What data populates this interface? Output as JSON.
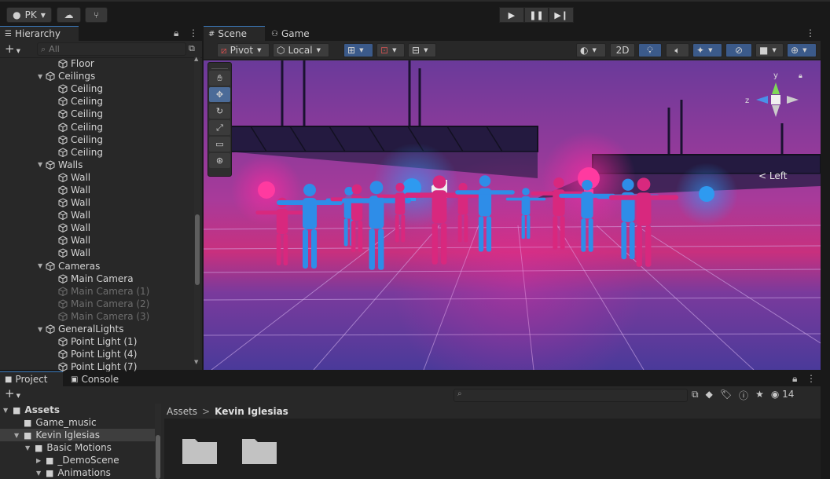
{
  "toolbar": {
    "account_label": "PK",
    "cloud_icon": "cloud-icon",
    "collab_icon": "branch-icon",
    "play_icon": "play-icon",
    "pause_icon": "pause-icon",
    "step_icon": "step-icon"
  },
  "hierarchy": {
    "tab_label": "Hierarchy",
    "add_label": "+",
    "search_placeholder": "All",
    "items": [
      {
        "label": "Floor",
        "depth": 2,
        "dim": false,
        "expander": ""
      },
      {
        "label": "Ceilings",
        "depth": 1,
        "dim": false,
        "expander": "▼"
      },
      {
        "label": "Ceiling",
        "depth": 2,
        "dim": false,
        "expander": ""
      },
      {
        "label": "Ceiling",
        "depth": 2,
        "dim": false,
        "expander": ""
      },
      {
        "label": "Ceiling",
        "depth": 2,
        "dim": false,
        "expander": ""
      },
      {
        "label": "Ceiling",
        "depth": 2,
        "dim": false,
        "expander": ""
      },
      {
        "label": "Ceiling",
        "depth": 2,
        "dim": false,
        "expander": ""
      },
      {
        "label": "Ceiling",
        "depth": 2,
        "dim": false,
        "expander": ""
      },
      {
        "label": "Walls",
        "depth": 1,
        "dim": false,
        "expander": "▼"
      },
      {
        "label": "Wall",
        "depth": 2,
        "dim": false,
        "expander": ""
      },
      {
        "label": "Wall",
        "depth": 2,
        "dim": false,
        "expander": ""
      },
      {
        "label": "Wall",
        "depth": 2,
        "dim": false,
        "expander": ""
      },
      {
        "label": "Wall",
        "depth": 2,
        "dim": false,
        "expander": ""
      },
      {
        "label": "Wall",
        "depth": 2,
        "dim": false,
        "expander": ""
      },
      {
        "label": "Wall",
        "depth": 2,
        "dim": false,
        "expander": ""
      },
      {
        "label": "Wall",
        "depth": 2,
        "dim": false,
        "expander": ""
      },
      {
        "label": "Cameras",
        "depth": 1,
        "dim": false,
        "expander": "▼"
      },
      {
        "label": "Main Camera",
        "depth": 2,
        "dim": false,
        "expander": ""
      },
      {
        "label": "Main Camera (1)",
        "depth": 2,
        "dim": true,
        "expander": ""
      },
      {
        "label": "Main Camera (2)",
        "depth": 2,
        "dim": true,
        "expander": ""
      },
      {
        "label": "Main Camera (3)",
        "depth": 2,
        "dim": true,
        "expander": ""
      },
      {
        "label": "GeneralLights",
        "depth": 1,
        "dim": false,
        "expander": "▼"
      },
      {
        "label": "Point Light (1)",
        "depth": 2,
        "dim": false,
        "expander": ""
      },
      {
        "label": "Point Light (4)",
        "depth": 2,
        "dim": false,
        "expander": ""
      },
      {
        "label": "Point Light (7)",
        "depth": 2,
        "dim": false,
        "expander": ""
      }
    ]
  },
  "scene": {
    "tabs": [
      {
        "label": "Scene",
        "icon": "grid-icon"
      },
      {
        "label": "Game",
        "icon": "gamepad-icon"
      }
    ],
    "pivot_label": "Pivot",
    "local_label": "Local",
    "mode_2d_label": "2D",
    "gizmo_view_label": "< Left",
    "gizmo_y_label": "y",
    "gizmo_z_label": "z"
  },
  "bottom": {
    "tabs": [
      {
        "label": "Project",
        "icon": "folder-icon"
      },
      {
        "label": "Console",
        "icon": "console-icon"
      }
    ],
    "add_label": "+",
    "hidden_count": "14",
    "breadcrumb_root": "Assets",
    "breadcrumb_sep": ">",
    "breadcrumb_current": "Kevin Iglesias",
    "tree": [
      {
        "label": "Assets",
        "depth": 0,
        "expander": "▼",
        "selected": false,
        "bold": true
      },
      {
        "label": "Game_music",
        "depth": 1,
        "expander": "",
        "selected": false,
        "bold": false
      },
      {
        "label": "Kevin Iglesias",
        "depth": 1,
        "expander": "▼",
        "selected": true,
        "bold": false
      },
      {
        "label": "Basic Motions",
        "depth": 2,
        "expander": "▼",
        "selected": false,
        "bold": false
      },
      {
        "label": "_DemoScene",
        "depth": 3,
        "expander": "▶",
        "selected": false,
        "bold": false
      },
      {
        "label": "Animations",
        "depth": 3,
        "expander": "▼",
        "selected": false,
        "bold": false
      }
    ]
  },
  "colors": {
    "accent": "#3a79bb",
    "panel_bg": "#282828",
    "toolbar_bg": "#191919",
    "scene_magenta": "#d8287e",
    "scene_blue": "#2e8de8"
  }
}
